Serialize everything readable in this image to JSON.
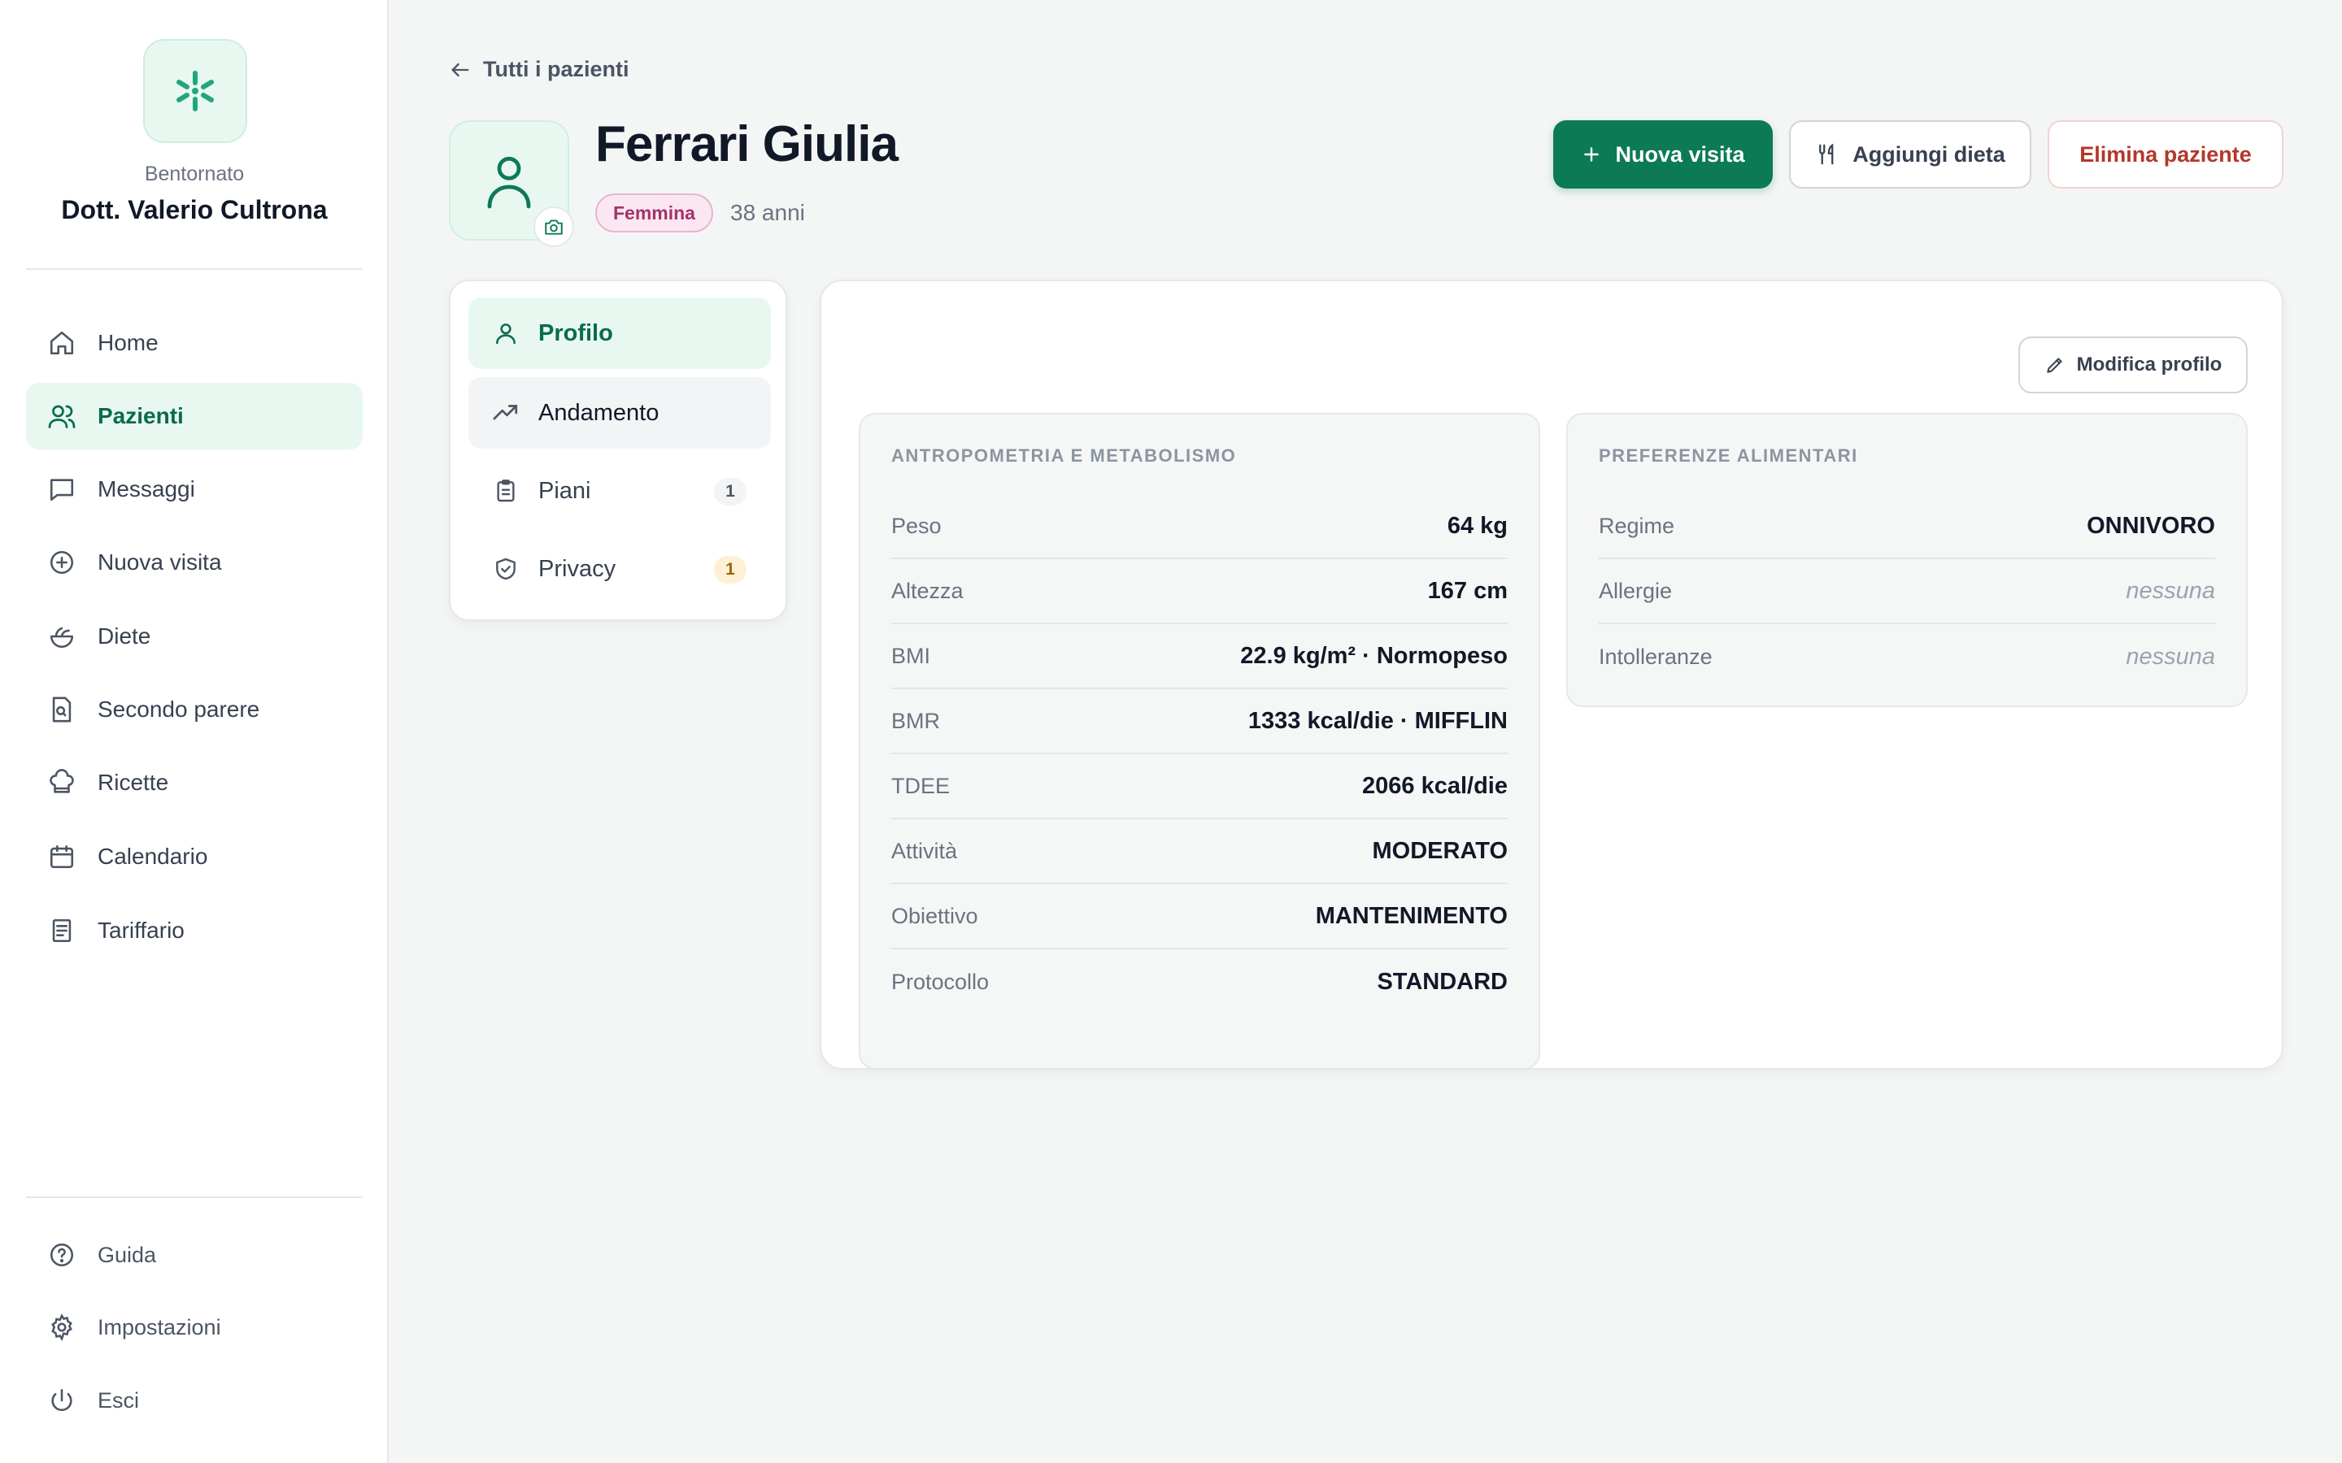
{
  "sidebar": {
    "brand": "Bentornato",
    "doctor": "Dott. Valerio Cultrona",
    "nav": [
      {
        "label": "Home",
        "icon": "home-icon"
      },
      {
        "label": "Pazienti",
        "icon": "users-icon"
      },
      {
        "label": "Messaggi",
        "icon": "message-icon"
      },
      {
        "label": "Nuova visita",
        "icon": "plus-circle-icon"
      },
      {
        "label": "Diete",
        "icon": "salad-icon"
      },
      {
        "label": "Secondo parere",
        "icon": "file-search-icon"
      },
      {
        "label": "Ricette",
        "icon": "chef-hat-icon"
      },
      {
        "label": "Calendario",
        "icon": "calendar-icon"
      },
      {
        "label": "Tariffario",
        "icon": "receipt-icon"
      }
    ],
    "footer": [
      {
        "label": "Guida",
        "icon": "help-icon"
      },
      {
        "label": "Impostazioni",
        "icon": "gear-icon"
      },
      {
        "label": "Esci",
        "icon": "power-icon"
      }
    ]
  },
  "header": {
    "back_label": "Tutti i pazienti",
    "patient_name": "Ferrari Giulia",
    "gender": "Femmina",
    "age": "38 anni",
    "buttons": {
      "new_visit": "Nuova visita",
      "add_diet": "Aggiungi dieta",
      "delete_patient": "Elimina paziente"
    }
  },
  "tabs": [
    {
      "label": "Profilo",
      "icon": "user-icon"
    },
    {
      "label": "Andamento",
      "icon": "trending-up-icon"
    },
    {
      "label": "Piani",
      "icon": "clipboard-icon",
      "count": "1"
    },
    {
      "label": "Privacy",
      "icon": "shield-check-icon",
      "count": "1"
    }
  ],
  "profile": {
    "edit_label": "Modifica profilo",
    "anthropometry": {
      "title": "ANTROPOMETRIA E METABOLISMO",
      "rows": [
        {
          "label": "Peso",
          "value": "64 kg"
        },
        {
          "label": "Altezza",
          "value": "167 cm"
        },
        {
          "label": "BMI",
          "value": "22.9 kg/m² · Normopeso"
        },
        {
          "label": "BMR",
          "value": "1333 kcal/die · MIFFLIN"
        },
        {
          "label": "TDEE",
          "value": "2066 kcal/die"
        },
        {
          "label": "Attività",
          "value": "MODERATO"
        },
        {
          "label": "Obiettivo",
          "value": "MANTENIMENTO"
        },
        {
          "label": "Protocollo",
          "value": "STANDARD"
        }
      ]
    },
    "preferences": {
      "title": "PREFERENZE ALIMENTARI",
      "rows": [
        {
          "label": "Regime",
          "value": "ONNIVORO"
        },
        {
          "label": "Allergie",
          "value": "nessuna"
        },
        {
          "label": "Intolleranze",
          "value": "nessuna"
        }
      ]
    }
  },
  "colors": {
    "accent": "#0d7a56",
    "accent_soft": "#e8f8f1",
    "danger": "#b4372a",
    "badge_pink": "#a3326c",
    "background": "#f4f6f6"
  }
}
